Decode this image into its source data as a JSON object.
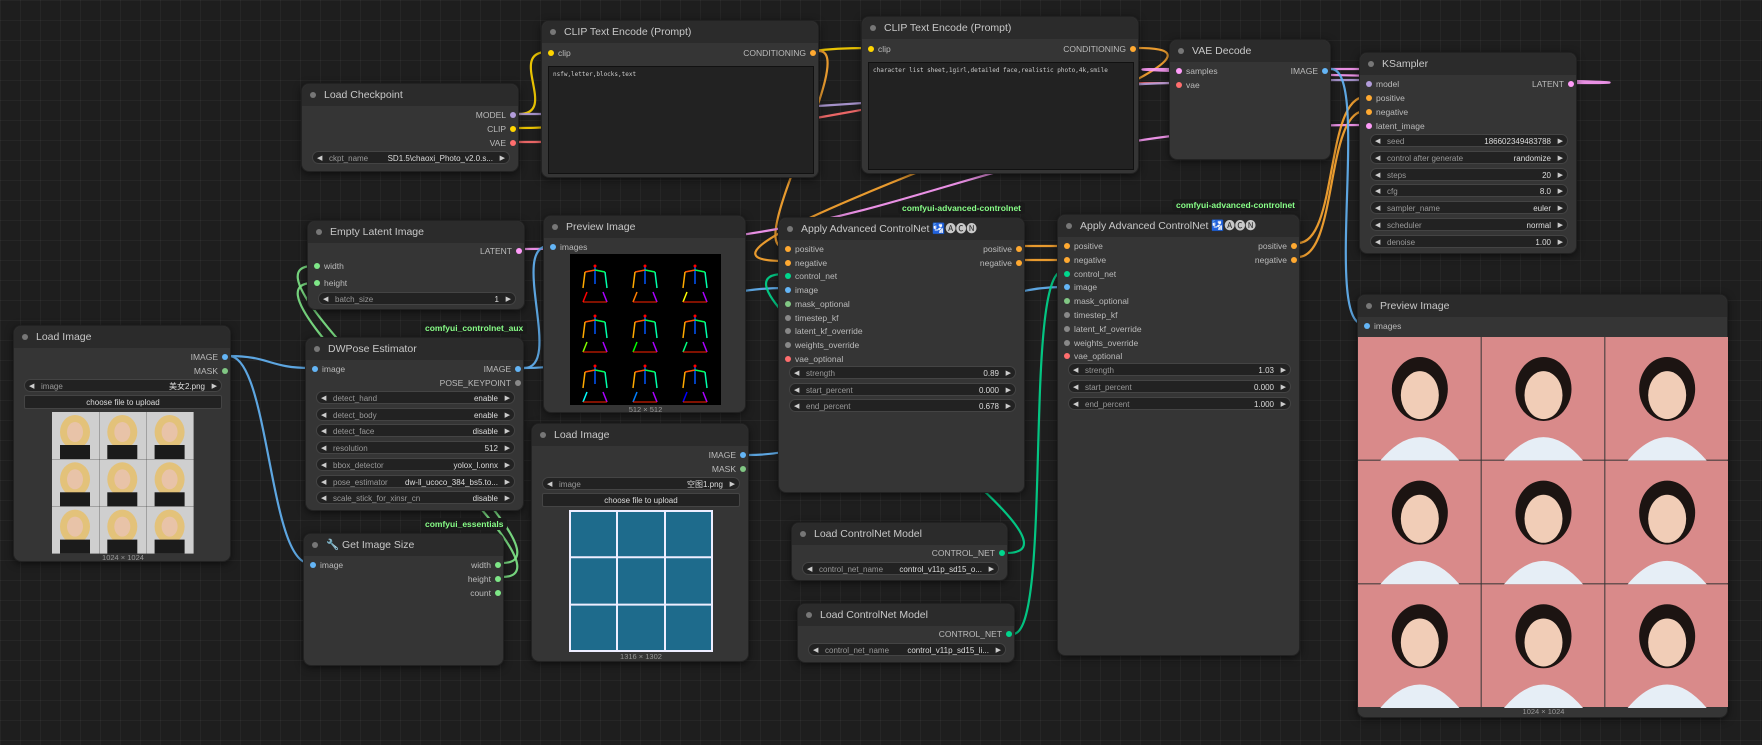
{
  "colors": {
    "image": "#64b5f6",
    "mask": "#81c784",
    "model": "#b39ddb",
    "clip": "#ffd500",
    "vae": "#ff6e6e",
    "conditioning": "#ffa931",
    "latent": "#ff9cf9",
    "int": "#7ee787",
    "control_net": "#00d78d",
    "pose": "#888888"
  },
  "nodes": {
    "load_checkpoint": {
      "title": "Load Checkpoint",
      "outputs": [
        "MODEL",
        "CLIP",
        "VAE"
      ],
      "ckpt_label": "ckpt_name",
      "ckpt_value": "SD1.5\\chaoxi_Photo_v2.0.s..."
    },
    "clip_neg": {
      "title": "CLIP Text Encode (Prompt)",
      "input": "clip",
      "output": "CONDITIONING",
      "text": "nsfw,letter,blocks,text"
    },
    "clip_pos": {
      "title": "CLIP Text Encode (Prompt)",
      "input": "clip",
      "output": "CONDITIONING",
      "text": "character list sheet,1girl,detailed face,realistic photo,4k,smile"
    },
    "vae_decode": {
      "title": "VAE Decode",
      "inputs": [
        "samples",
        "vae"
      ],
      "output": "IMAGE"
    },
    "ksampler": {
      "title": "KSampler",
      "inputs": [
        "model",
        "positive",
        "negative",
        "latent_image"
      ],
      "output": "LATENT",
      "widgets": [
        {
          "label": "seed",
          "value": "186602349483788"
        },
        {
          "label": "control after generate",
          "value": "randomize"
        },
        {
          "label": "steps",
          "value": "20"
        },
        {
          "label": "cfg",
          "value": "8.0"
        },
        {
          "label": "sampler_name",
          "value": "euler"
        },
        {
          "label": "scheduler",
          "value": "normal"
        },
        {
          "label": "denoise",
          "value": "1.00"
        }
      ]
    },
    "empty_latent": {
      "title": "Empty Latent Image",
      "output": "LATENT",
      "inputs": [
        "width",
        "height"
      ],
      "batch_label": "batch_size",
      "batch_value": "1"
    },
    "preview_pose": {
      "title": "Preview Image",
      "input": "images",
      "caption": "512 × 512"
    },
    "load_image_1": {
      "title": "Load Image",
      "outputs": [
        "IMAGE",
        "MASK"
      ],
      "image_label": "image",
      "image_value": "美女2.png",
      "upload_label": "choose file to upload",
      "caption": "1024 × 1024"
    },
    "dwpose": {
      "title": "DWPose Estimator",
      "input": "image",
      "outputs": [
        "IMAGE",
        "POSE_KEYPOINT"
      ],
      "widgets": [
        {
          "label": "detect_hand",
          "value": "enable"
        },
        {
          "label": "detect_body",
          "value": "enable"
        },
        {
          "label": "detect_face",
          "value": "disable"
        },
        {
          "label": "resolution",
          "value": "512"
        },
        {
          "label": "bbox_detector",
          "value": "yolox_l.onnx"
        },
        {
          "label": "pose_estimator",
          "value": "dw-ll_ucoco_384_bs5.to..."
        },
        {
          "label": "scale_stick_for_xinsr_cn",
          "value": "disable"
        }
      ]
    },
    "get_image_size": {
      "title": "🔧 Get Image Size",
      "input": "image",
      "outputs": [
        "width",
        "height",
        "count"
      ]
    },
    "load_image_2": {
      "title": "Load Image",
      "outputs": [
        "IMAGE",
        "MASK"
      ],
      "image_label": "image",
      "image_value": "空图1.png",
      "upload_label": "choose file to upload",
      "caption": "1316 × 1302"
    },
    "acn1": {
      "title": "Apply Advanced ControlNet 🛂🅐🅒🅝",
      "inputs": [
        "positive",
        "negative",
        "control_net",
        "image",
        "mask_optional",
        "timestep_kf",
        "latent_kf_override",
        "weights_override",
        "vae_optional"
      ],
      "outputs": [
        "positive",
        "negative"
      ],
      "widgets": [
        {
          "label": "strength",
          "value": "0.89"
        },
        {
          "label": "start_percent",
          "value": "0.000"
        },
        {
          "label": "end_percent",
          "value": "0.678"
        }
      ]
    },
    "acn2": {
      "title": "Apply Advanced ControlNet 🛂🅐🅒🅝",
      "inputs": [
        "positive",
        "negative",
        "control_net",
        "image",
        "mask_optional",
        "timestep_kf",
        "latent_kf_override",
        "weights_override",
        "vae_optional"
      ],
      "outputs": [
        "positive",
        "negative"
      ],
      "widgets": [
        {
          "label": "strength",
          "value": "1.03"
        },
        {
          "label": "start_percent",
          "value": "0.000"
        },
        {
          "label": "end_percent",
          "value": "1.000"
        }
      ]
    },
    "load_cn_1": {
      "title": "Load ControlNet Model",
      "output": "CONTROL_NET",
      "widget_label": "control_net_name",
      "widget_value": "control_v11p_sd15_o..."
    },
    "load_cn_2": {
      "title": "Load ControlNet Model",
      "output": "CONTROL_NET",
      "widget_label": "control_net_name",
      "widget_value": "control_v11p_sd15_li..."
    },
    "preview_final": {
      "title": "Preview Image",
      "input": "images",
      "caption": "1024 × 1024"
    }
  },
  "badges": {
    "aux": "comfyui_controlnet_aux",
    "essentials": "comfyui_essentials",
    "acn1": "comfyui-advanced-controlnet",
    "acn2": "comfyui-advanced-controlnet"
  }
}
